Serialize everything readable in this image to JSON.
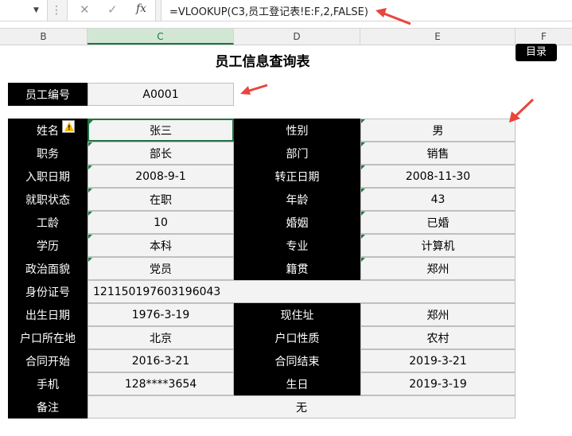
{
  "formula_bar": {
    "cancel_glyph": "✕",
    "confirm_glyph": "✓",
    "fx": "fx",
    "formula": "=VLOOKUP(C3,员工登记表!E:F,2,FALSE)"
  },
  "columns": [
    "B",
    "C",
    "D",
    "E",
    "F"
  ],
  "sheet": {
    "title": "员工信息查询表",
    "menu_button": "目录",
    "lookup_label": "员工编号",
    "lookup_value": "A0001"
  },
  "rows": [
    {
      "l1": "姓名",
      "v1": "张三",
      "l2": "性别",
      "v2": "男"
    },
    {
      "l1": "职务",
      "v1": "部长",
      "l2": "部门",
      "v2": "销售"
    },
    {
      "l1": "入职日期",
      "v1": "2008-9-1",
      "l2": "转正日期",
      "v2": "2008-11-30"
    },
    {
      "l1": "就职状态",
      "v1": "在职",
      "l2": "年龄",
      "v2": "43"
    },
    {
      "l1": "工龄",
      "v1": "10",
      "l2": "婚姻",
      "v2": "已婚"
    },
    {
      "l1": "学历",
      "v1": "本科",
      "l2": "专业",
      "v2": "计算机"
    },
    {
      "l1": "政治面貌",
      "v1": "党员",
      "l2": "籍贯",
      "v2": "郑州"
    },
    {
      "l1": "身份证号",
      "v1": "121150197603196043",
      "l2": "",
      "v2": ""
    },
    {
      "l1": "出生日期",
      "v1": "1976-3-19",
      "l2": "现住址",
      "v2": "郑州"
    },
    {
      "l1": "户口所在地",
      "v1": "北京",
      "l2": "户口性质",
      "v2": "农村"
    },
    {
      "l1": "合同开始",
      "v1": "2016-3-21",
      "l2": "合同结束",
      "v2": "2019-3-21"
    },
    {
      "l1": "手机",
      "v1": "128****3654",
      "l2": "生日",
      "v2": "2019-3-19"
    },
    {
      "l1": "备注",
      "v1": "无",
      "l2": "",
      "v2": ""
    }
  ],
  "colors": {
    "accent": "#217346",
    "arrow": "#e8453c",
    "label_bg": "#000000"
  }
}
